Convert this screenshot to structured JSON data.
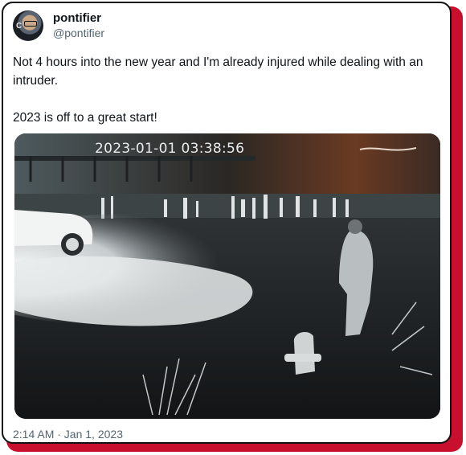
{
  "author": {
    "display_name": "pontifier",
    "handle": "@pontifier"
  },
  "tweet": {
    "text": "Not 4 hours into the new year and I'm already injured while dealing with an intruder.\n\n2023 is off to a great start!",
    "posted_at": "2:14 AM · Jan 1, 2023"
  },
  "media": {
    "camera_timestamp": "2023-01-01 03:38:56"
  },
  "colors": {
    "accent_border": "#c8102e",
    "text_primary": "#0f1419",
    "text_secondary": "#536471"
  }
}
